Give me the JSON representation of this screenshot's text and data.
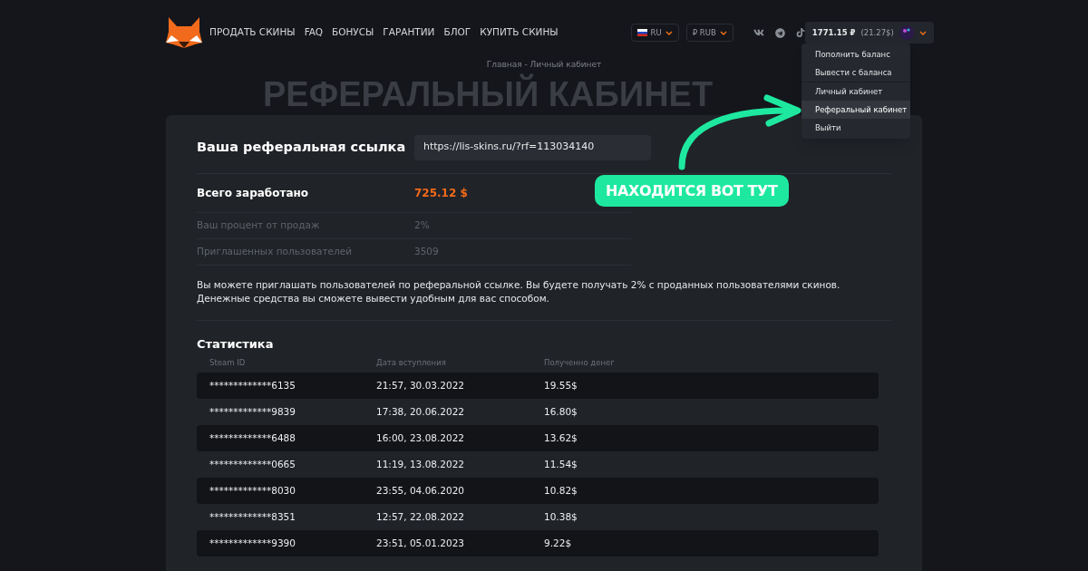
{
  "nav": [
    "ПРОДАТЬ СКИНЫ",
    "FAQ",
    "БОНУСЫ",
    "ГАРАНТИИ",
    "БЛОГ",
    "КУПИТЬ СКИНЫ"
  ],
  "language": "RU",
  "currency": "₽ RUB",
  "balance": {
    "amount": "1771.15 ₽",
    "usd": "(21.27$)"
  },
  "menu": [
    {
      "label": "Пополнить баланс",
      "selected": false,
      "divider_above": false
    },
    {
      "label": "Вывести с баланса",
      "selected": false,
      "divider_above": false
    },
    {
      "label": "Личный кабинет",
      "selected": false,
      "divider_above": true
    },
    {
      "label": "Реферальный кабинет",
      "selected": true,
      "divider_above": false
    },
    {
      "label": "Выйти",
      "selected": false,
      "divider_above": false
    }
  ],
  "breadcrumb": "Главная - Личный кабинет",
  "heading": "РЕФЕРАЛЬНЫЙ КАБИНЕТ",
  "link": {
    "label": "Ваша реферальная ссылка",
    "value": "https://lis-skins.ru/?rf=113034140"
  },
  "stats": [
    {
      "label": "Всего заработано",
      "value": "725.12 $",
      "kind": "main"
    },
    {
      "label": "Ваш процент от продаж",
      "value": "2%",
      "kind": "minor"
    },
    {
      "label": "Приглашенных пользователей",
      "value": "3509",
      "kind": "minor"
    }
  ],
  "info": [
    "Вы можете приглашать пользователей по реферальной ссылке. Вы будете получать 2% с проданных пользователями скинов.",
    "Денежные средства вы сможете вывести удобным для вас способом."
  ],
  "table": {
    "title": "Статистика",
    "columns": [
      "Steam ID",
      "Дата вступления",
      "Полученно денег"
    ],
    "rows": [
      [
        "*************6135",
        "21:57, 30.03.2022",
        "19.55$"
      ],
      [
        "*************9839",
        "17:38, 20.06.2022",
        "16.80$"
      ],
      [
        "*************6488",
        "16:00, 23.08.2022",
        "13.62$"
      ],
      [
        "*************0665",
        "11:19, 13.08.2022",
        "11.54$"
      ],
      [
        "*************8030",
        "23:55, 04.06.2020",
        "10.82$"
      ],
      [
        "*************8351",
        "12:57, 22.08.2022",
        "10.38$"
      ],
      [
        "*************9390",
        "23:51, 05.01.2023",
        "9.22$"
      ]
    ]
  },
  "annotation": "НАХОДИТСЯ ВОТ ТУТ"
}
